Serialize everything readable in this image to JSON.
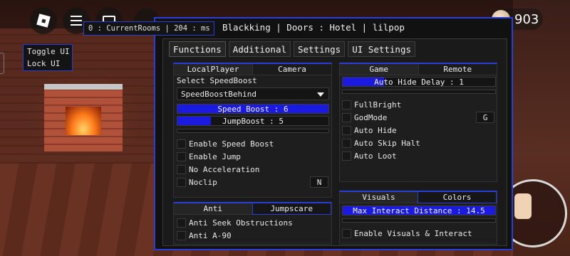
{
  "hud": {
    "coins": "903",
    "status": "0 : CurrentRooms | 204 : ms",
    "toggle_ui": "Toggle UI",
    "lock_ui": "Lock UI"
  },
  "window": {
    "title": "Blackking | Doors : Hotel | lilpop",
    "tabs": [
      "Functions",
      "Additional",
      "Settings",
      "UI Settings"
    ]
  },
  "player_panel": {
    "tabs": [
      "LocalPlayer",
      "Camera"
    ],
    "select_label": "Select SpeedBoost",
    "dropdown_value": "SpeedBoostBehind",
    "speed_boost": {
      "label": "Speed Boost : 6",
      "fill": 1.0
    },
    "jump_boost": {
      "label": "JumpBoost : 5",
      "fill": 0.22
    },
    "options": [
      "Enable Speed Boost",
      "Enable Jump",
      "No Acceleration",
      "Noclip"
    ],
    "noclip_key": "N"
  },
  "anti_panel": {
    "tabs": [
      "Anti",
      "Jumpscare"
    ],
    "options": [
      "Anti Seek Obstructions",
      "Anti A-90"
    ]
  },
  "game_panel": {
    "tabs": [
      "Game",
      "Remote"
    ],
    "auto_hide_delay": {
      "label": "Auto Hide Delay : 1",
      "fill": 0.27
    },
    "options": [
      "FullBright",
      "GodMode",
      "Auto Hide",
      "Auto Skip Halt",
      "Auto Loot"
    ],
    "godmode_key": "G"
  },
  "visuals_panel": {
    "tabs": [
      "Visuals",
      "Colors"
    ],
    "max_interact": {
      "label": "Max Interact Distance : 14.5",
      "fill": 1.0
    },
    "options": [
      "Enable Visuals & Interact"
    ]
  },
  "colors": {
    "accent": "#2a3fd8",
    "slider_fill": "#1a1ae0",
    "background": "#111111"
  }
}
